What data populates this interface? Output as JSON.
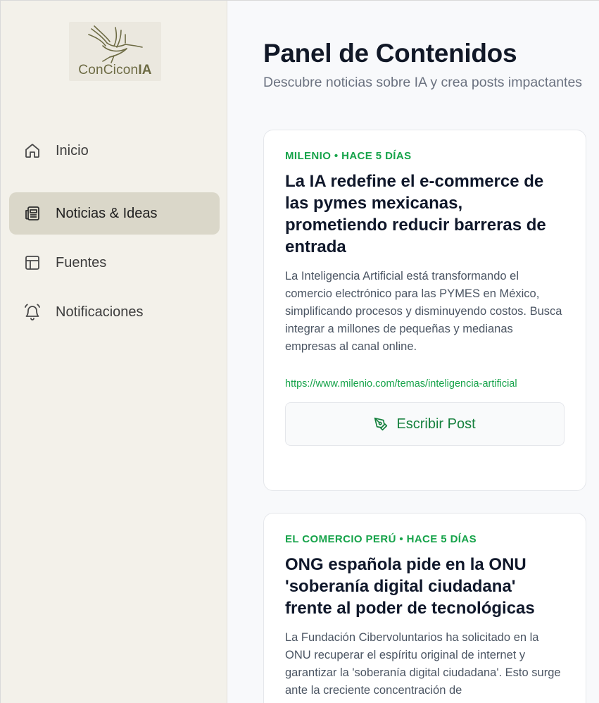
{
  "brand": {
    "logo_text_regular": "ConCicon",
    "logo_text_bold": "IA"
  },
  "sidebar": {
    "items": [
      {
        "label": "Inicio",
        "icon": "home-icon",
        "active": false
      },
      {
        "label": "Noticias & Ideas",
        "icon": "newspaper-icon",
        "active": true
      },
      {
        "label": "Fuentes",
        "icon": "layout-icon",
        "active": false
      },
      {
        "label": "Notificaciones",
        "icon": "bell-icon",
        "active": false
      }
    ]
  },
  "header": {
    "title": "Panel de Contenidos",
    "subtitle": "Descubre noticias sobre IA y crea posts impactantes"
  },
  "cards": [
    {
      "meta": "MILENIO • HACE 5 DÍAS",
      "title": "La IA redefine el e-commerce de las pymes mexicanas, prometiendo reducir barreras de entrada",
      "body": "La Inteligencia Artificial está transformando el comercio electrónico para las PYMES en México, simplificando procesos y disminuyendo costos. Busca integrar a millones de pequeñas y medianas empresas al canal online.",
      "url": "https://www.milenio.com/temas/inteligencia-artificial",
      "button_label": "Escribir Post"
    },
    {
      "meta": "EL COMERCIO PERÚ • HACE 5 DÍAS",
      "title": "ONG española pide en la ONU 'soberanía digital ciudadana' frente al poder de tecnológicas",
      "body": "La Fundación Cibervoluntarios ha solicitado en la ONU recuperar el espíritu original de internet y garantizar la 'soberanía digital ciudadana'. Esto surge ante la creciente concentración de"
    }
  ],
  "colors": {
    "accent_green": "#16a34a",
    "sidebar_bg": "#f3f1ea",
    "active_item_bg": "#dad7c9"
  }
}
